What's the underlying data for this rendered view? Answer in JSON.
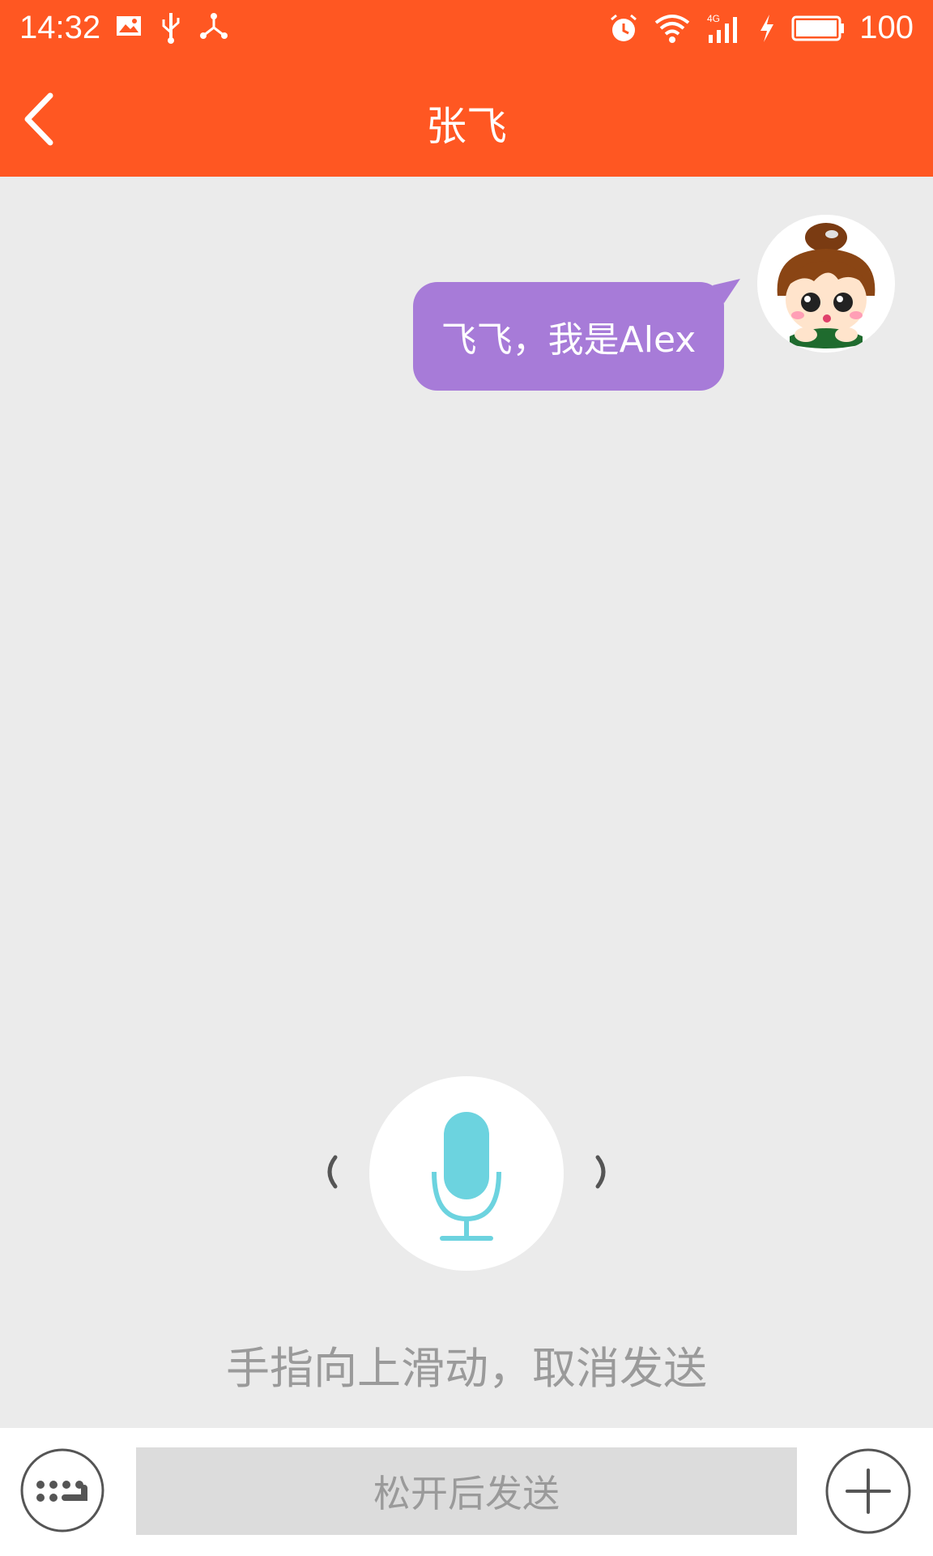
{
  "status_bar": {
    "time": "14:32",
    "battery": "100",
    "icons_left": [
      "image-icon",
      "usb-icon",
      "share-icon"
    ],
    "icons_right": [
      "alarm-icon",
      "wifi-icon",
      "signal-4g-icon",
      "charging-icon",
      "battery-icon"
    ]
  },
  "header": {
    "title": "张飞",
    "back_icon": "chevron-left-icon"
  },
  "chat": {
    "messages": [
      {
        "sender": "self",
        "text": "飞飞，我是Alex"
      }
    ]
  },
  "recording": {
    "hint": "手指向上滑动，取消发送"
  },
  "input_bar": {
    "hold_label": "松开后发送",
    "left_icon": "keyboard-icon",
    "right_icon": "plus-icon"
  },
  "colors": {
    "accent": "#ff5722",
    "bubble": "#a77bd8",
    "mic": "#6cd3df",
    "background": "#ebebeb"
  }
}
